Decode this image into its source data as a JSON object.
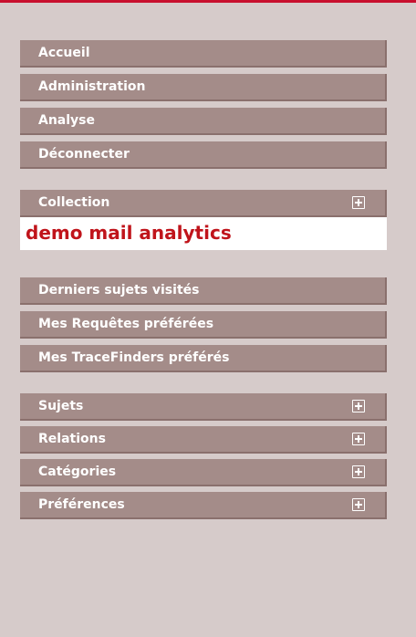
{
  "colors": {
    "top_rule": "#c8102e",
    "panel_bg": "#d6cbca",
    "item_bg": "#a48c89",
    "item_text": "#ffffff",
    "collection_value_text": "#c0141b"
  },
  "main_nav": [
    {
      "label": "Accueil"
    },
    {
      "label": "Administration"
    },
    {
      "label": "Analyse"
    },
    {
      "label": "Déconnecter"
    }
  ],
  "collection": {
    "label": "Collection",
    "icon": "plus-box-icon",
    "value": "demo mail analytics"
  },
  "favorites_nav": [
    {
      "label": "Derniers sujets visités"
    },
    {
      "label": "Mes Requêtes préférées"
    },
    {
      "label": "Mes TraceFinders préférés"
    }
  ],
  "expandable_nav": [
    {
      "label": "Sujets",
      "icon": "plus-box-icon"
    },
    {
      "label": "Relations",
      "icon": "plus-box-icon"
    },
    {
      "label": "Catégories",
      "icon": "plus-box-icon"
    },
    {
      "label": "Préférences",
      "icon": "plus-box-icon"
    }
  ]
}
